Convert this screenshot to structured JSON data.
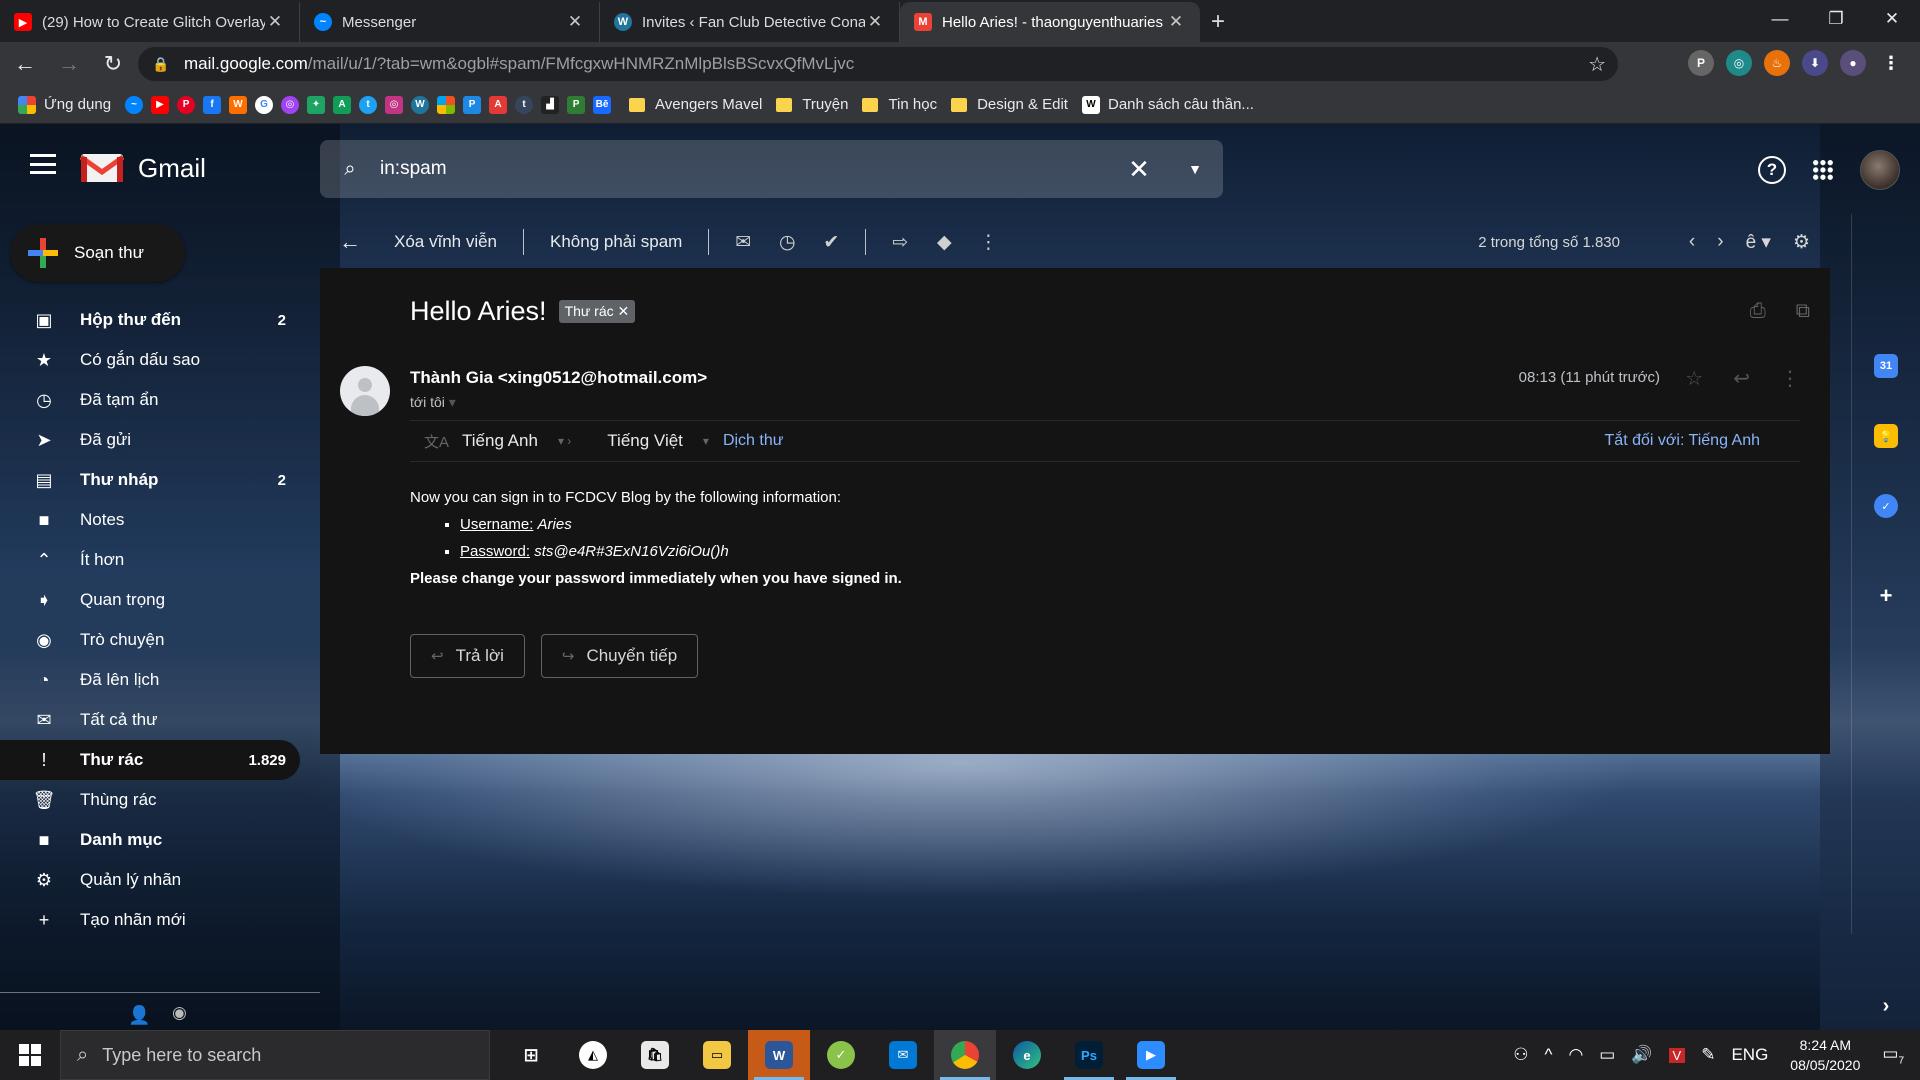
{
  "browser": {
    "tabs": [
      {
        "title": "(29) How to Create Glitch Overlay",
        "favicon": "youtube-icon",
        "color": "#ff0000"
      },
      {
        "title": "Messenger",
        "favicon": "messenger-icon",
        "color": "#0084ff"
      },
      {
        "title": "Invites ‹ Fan Club Detective Conan",
        "favicon": "wordpress-icon",
        "color": "#21759b"
      },
      {
        "title": "Hello Aries! - thaonguyenthuaries",
        "favicon": "gmail-icon",
        "color": "#ea4335"
      }
    ],
    "url_domain": "mail.google.com",
    "url_path": "/mail/u/1/?tab=wm&ogbl#spam/FMfcgxwHNMRZnMlpBlsBScvxQfMvLjvc",
    "bookmarks": {
      "apps_label": "Ứng dụng",
      "folders": [
        "Avengers Mavel",
        "Truyện",
        "Tin học",
        "Design & Edit"
      ],
      "last": "Danh sách câu thần..."
    }
  },
  "gmail": {
    "app_name": "Gmail",
    "search_query": "in:spam",
    "compose_label": "Soạn thư",
    "nav": [
      {
        "label": "Hộp thư đến",
        "count": "2",
        "icon": "inbox-icon",
        "glyph": "▣",
        "bold": true
      },
      {
        "label": "Có gắn dấu sao",
        "count": "",
        "icon": "star-icon",
        "glyph": "★"
      },
      {
        "label": "Đã tạm ẩn",
        "count": "",
        "icon": "clock-icon",
        "glyph": "◷"
      },
      {
        "label": "Đã gửi",
        "count": "",
        "icon": "send-icon",
        "glyph": "➤"
      },
      {
        "label": "Thư nháp",
        "count": "2",
        "icon": "draft-icon",
        "glyph": "▤",
        "bold": true
      },
      {
        "label": "Notes",
        "count": "",
        "icon": "label-icon",
        "glyph": "■"
      },
      {
        "label": "Ít hơn",
        "count": "",
        "icon": "chevron-up-icon",
        "glyph": "⌃"
      },
      {
        "label": "Quan trọng",
        "count": "",
        "icon": "important-icon",
        "glyph": "➧"
      },
      {
        "label": "Trò chuyện",
        "count": "",
        "icon": "chat-icon",
        "glyph": "◉"
      },
      {
        "label": "Đã lên lịch",
        "count": "",
        "icon": "scheduled-icon",
        "glyph": "◔"
      },
      {
        "label": "Tất cả thư",
        "count": "",
        "icon": "all-mail-icon",
        "glyph": "✉"
      },
      {
        "label": "Thư rác",
        "count": "1.829",
        "icon": "spam-icon",
        "glyph": "!",
        "bold": true,
        "active": true
      },
      {
        "label": "Thùng rác",
        "count": "",
        "icon": "trash-icon",
        "glyph": "🗑"
      },
      {
        "label": "Danh mục",
        "count": "",
        "icon": "category-icon",
        "glyph": "■",
        "bold": true
      },
      {
        "label": "Quản lý nhãn",
        "count": "",
        "icon": "gear-icon",
        "glyph": "⚙"
      },
      {
        "label": "Tạo nhãn mới",
        "count": "",
        "icon": "plus-icon",
        "glyph": "+"
      }
    ],
    "toolbar": {
      "delete_forever": "Xóa vĩnh viễn",
      "not_spam": "Không phải spam",
      "pager": "2 trong tổng số 1.830"
    },
    "message": {
      "subject": "Hello Aries!",
      "label_chip": "Thư rác",
      "sender": "Thành Gia <xing0512@hotmail.com>",
      "to": "tới tôi",
      "time": "08:13 (11 phút trước)",
      "translate": {
        "from_lang": "Tiếng Anh",
        "to_lang": "Tiếng Việt",
        "link": "Dịch thư",
        "off": "Tắt đối với: Tiếng Anh"
      },
      "body_intro": "Now you can sign in to FCDCV Blog by the following information:",
      "username_label": "Username:",
      "username_value": "Aries",
      "password_label": "Password:",
      "password_value": "sts@e4R#3ExN16Vzi6iOu()h",
      "body_outro": "Please change your password immediately when you have signed in.",
      "reply_label": "Trả lời",
      "forward_label": "Chuyển tiếp"
    }
  },
  "taskbar": {
    "search_placeholder": "Type here to search",
    "lang": "ENG",
    "time": "8:24 AM",
    "date": "08/05/2020",
    "notification_count": "7"
  }
}
